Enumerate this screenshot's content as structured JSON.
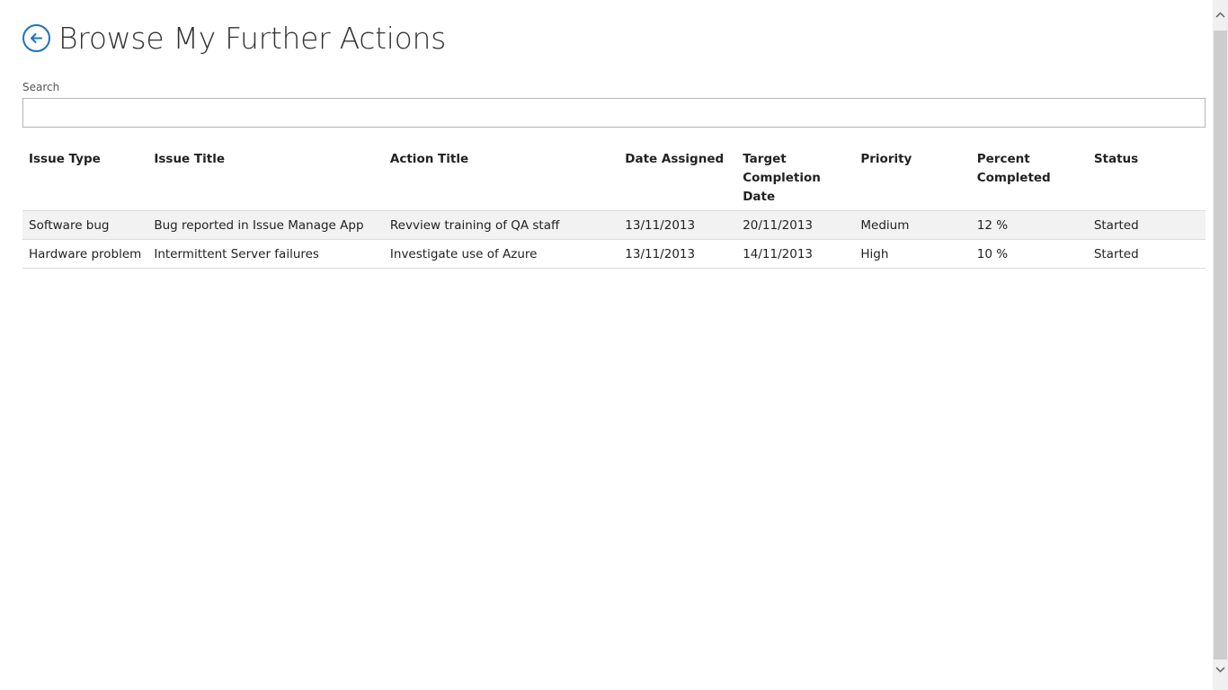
{
  "header": {
    "title": "Browse My Further Actions"
  },
  "search": {
    "label": "Search",
    "value": ""
  },
  "table": {
    "columns": [
      "Issue Type",
      "Issue Title",
      "Action Title",
      "Date Assigned",
      "Target Completion Date",
      "Priority",
      "Percent Completed",
      "Status"
    ],
    "rows": [
      {
        "issue_type": "Software bug",
        "issue_title": "Bug reported in Issue Manage App",
        "action_title": "Revview training of QA staff",
        "date_assigned": "13/11/2013",
        "target_completion_date": "20/11/2013",
        "priority": "Medium",
        "percent_completed": "12 %",
        "status": "Started"
      },
      {
        "issue_type": "Hardware problem",
        "issue_title": "Intermittent Server failures",
        "action_title": "Investigate use of Azure",
        "date_assigned": "13/11/2013",
        "target_completion_date": "14/11/2013",
        "priority": "High",
        "percent_completed": "10 %",
        "status": "Started"
      }
    ]
  },
  "colors": {
    "accent": "#1e73be",
    "row_alt": "#f2f2f2"
  },
  "icons": {
    "back": "back-arrow-circle-icon",
    "scroll_up": "chevron-up-icon",
    "scroll_down": "chevron-down-icon"
  }
}
